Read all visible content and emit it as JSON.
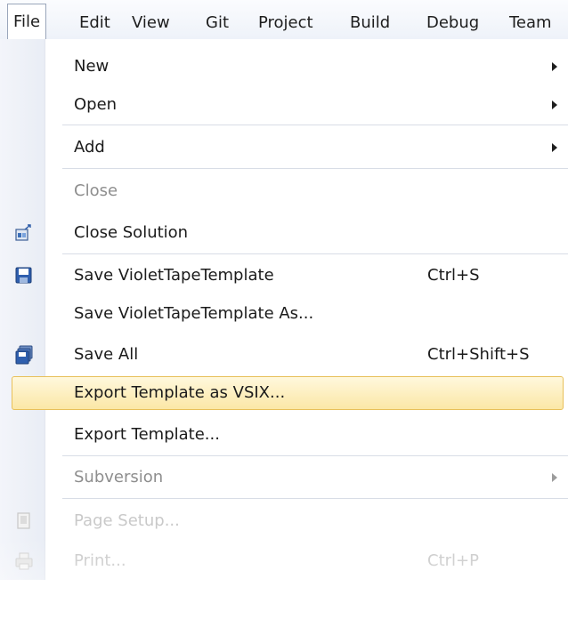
{
  "menubar": {
    "items": [
      "File",
      "Edit",
      "View",
      "Git",
      "Project",
      "Build",
      "Debug",
      "Team"
    ]
  },
  "file_menu": {
    "items": [
      {
        "label": "New",
        "submenu": true
      },
      {
        "label": "Open",
        "submenu": true
      },
      {
        "label": "Add",
        "submenu": true
      },
      {
        "label": "Close",
        "disabled": true
      },
      {
        "label": "Close Solution",
        "icon": "close-solution-icon"
      },
      {
        "label": "Save VioletTapeTemplate",
        "shortcut": "Ctrl+S",
        "icon": "floppy-disk-icon"
      },
      {
        "label": "Save VioletTapeTemplate As..."
      },
      {
        "label": "Save All",
        "shortcut": "Ctrl+Shift+S",
        "icon": "save-all-icon"
      },
      {
        "label": "Export Template as VSIX...",
        "highlighted": true
      },
      {
        "label": "Export Template..."
      },
      {
        "label": "Subversion",
        "submenu": true,
        "disabled": true
      },
      {
        "label": "Page Setup...",
        "disabled": true,
        "icon": "page-setup-icon"
      },
      {
        "label": "Print...",
        "shortcut": "Ctrl+P",
        "disabled": true,
        "icon": "printer-icon"
      }
    ]
  },
  "colors": {
    "highlight_fill": "#fbe7a6",
    "highlight_border": "#e8c05a",
    "disabled_text": "#8e8e8e"
  }
}
